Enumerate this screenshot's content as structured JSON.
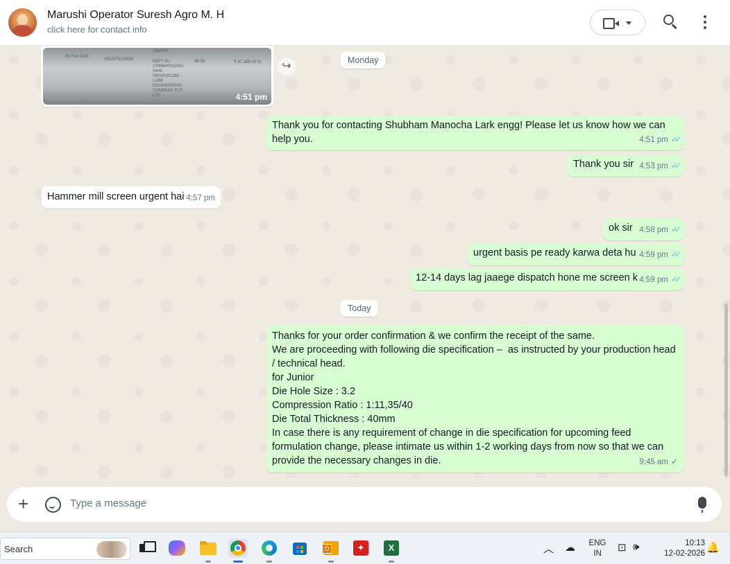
{
  "header": {
    "contact_name": "Marushi Operator Suresh Agro M. H",
    "contact_sub": "click here for contact info"
  },
  "image_message": {
    "time": "4:51 pm",
    "doc_lines": [
      "09 Feb 2026",
      "0912575126561",
      "JAVARE",
      "NEFT Dr-",
      "CNRBH0010941",
      "5449-",
      "SBIN0001293-",
      "LARK",
      "ENGINEERING",
      "COMPANY PVT",
      "LTD",
      "49.58",
      "₹ 47,399.00 Dr"
    ]
  },
  "dates": {
    "monday": "Monday",
    "today": "Today"
  },
  "messages": [
    {
      "text": "Thank you for contacting Shubham Manocha Lark engg! Please let us know how we can\nhelp you.",
      "time": "4:51 pm",
      "dir": "out"
    },
    {
      "text": "Thank you sir",
      "time": "4:53 pm",
      "dir": "out"
    },
    {
      "text": "Hammer mill screen urgent hai",
      "time": "4:57 pm",
      "dir": "in"
    },
    {
      "text": "ok sir",
      "time": "4:58 pm",
      "dir": "out"
    },
    {
      "text": "urgent basis pe ready karwa deta hu",
      "time": "4:59 pm",
      "dir": "out"
    },
    {
      "text": "12-14 days lag jaaege dispatch hone me screen k",
      "time": "4:59 pm",
      "dir": "out"
    },
    {
      "text": "Thanks for your order confirmation & we confirm the receipt of the same.\nWe are proceeding with following die specification –  as instructed by your production head\n/ technical head.\nfor Junior\nDie Hole Size : 3.2\nCompression Ratio : 1:11,35/40\nDie Total Thickness : 40mm\nIn case there is any requirement of change in die specification for upcoming feed\nformulation change, please intimate us within 1-2 working days from now so that we can\nprovide the necessary changes in die.",
      "time": "9:45 am",
      "dir": "out"
    }
  ],
  "composer": {
    "placeholder": "Type a message"
  },
  "taskbar": {
    "search_label": "Search",
    "lang_top": "ENG",
    "lang_bottom": "IN",
    "time": "10:13",
    "date": "12-02-2026"
  },
  "icons": {
    "read_receipt": "✓✓",
    "sent_receipt": "✓",
    "forward": "↪",
    "plus": "+"
  },
  "colors": {
    "outgoing_bubble": "#d9fdd3",
    "incoming_bubble": "#ffffff",
    "read_tick": "#53bdeb",
    "chat_bg": "#efeae2"
  }
}
